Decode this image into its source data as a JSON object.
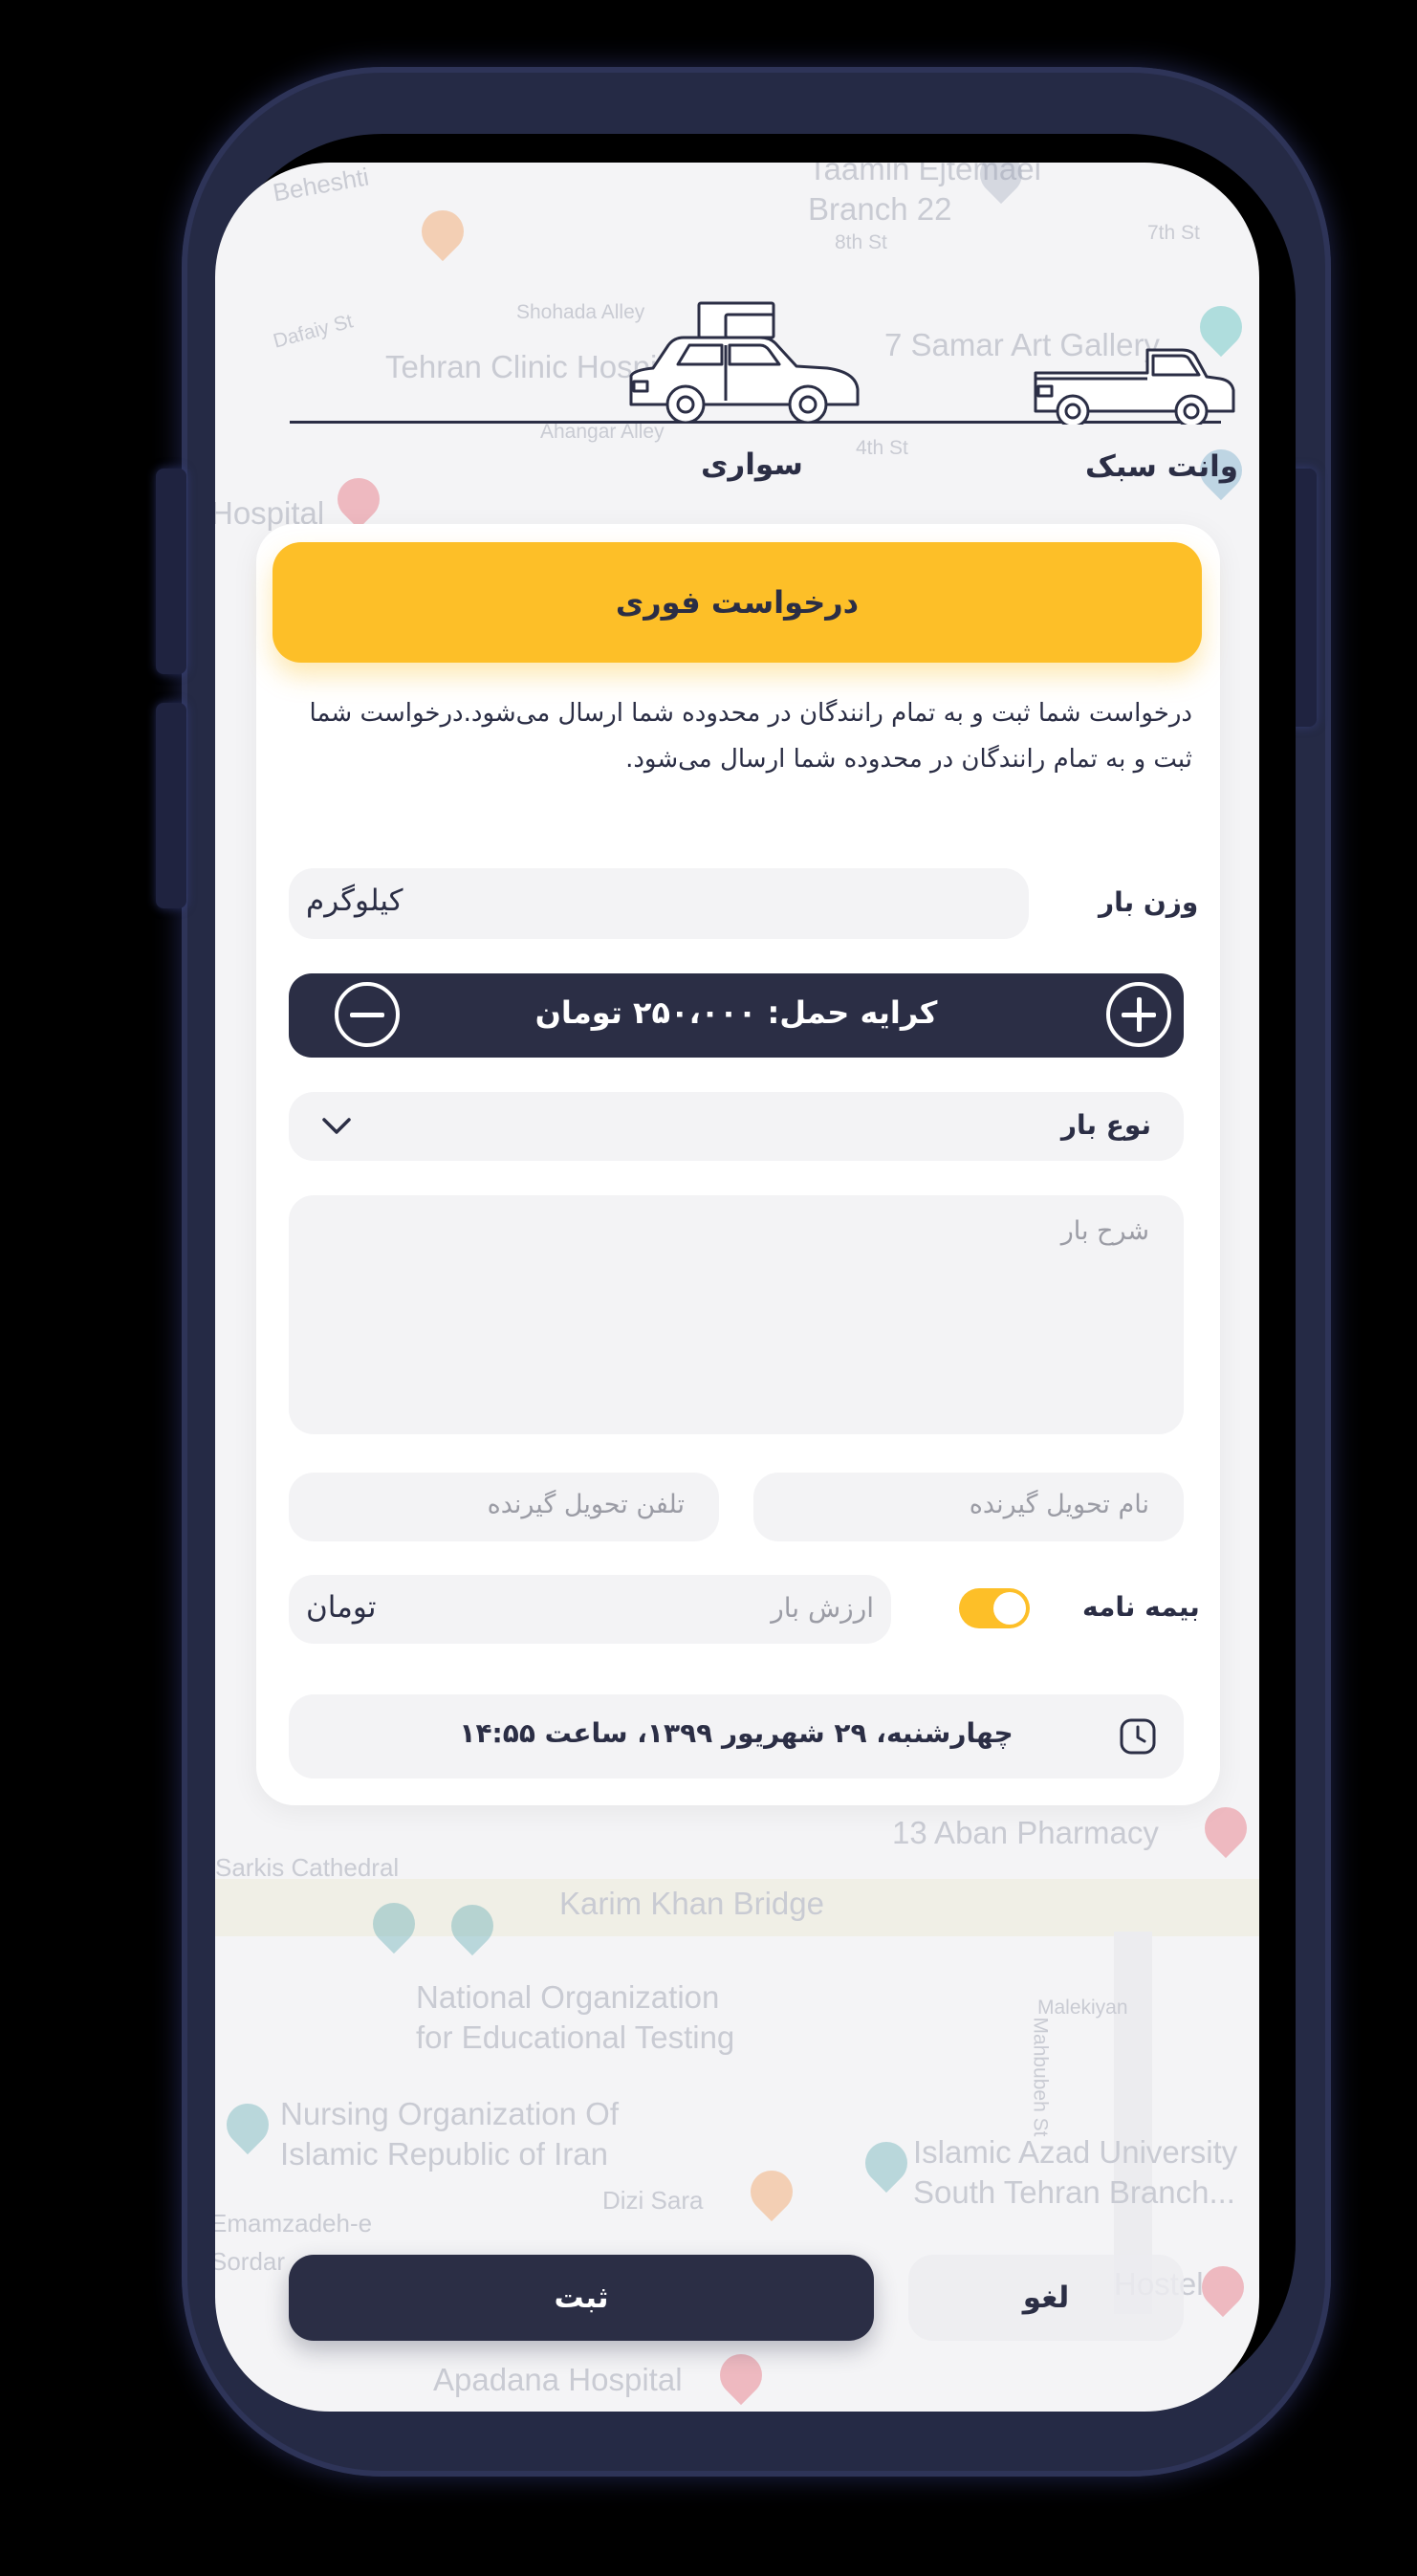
{
  "map": {
    "labels": [
      "Beheshti",
      "Taamin Ejtemaei",
      "Branch 22",
      "8th St",
      "7th St",
      "Shohada Alley",
      "Dafaiy St",
      "Tehran Clinic Hospital",
      "7 Samar Art Gallery",
      "Ahangar Alley",
      "4th St",
      "Hospital",
      "13 Aban Pharmacy",
      "Sarkis Cathedral",
      "Karim Khan Bridge",
      "National Organization",
      "for Educational Testing",
      "Mahbubeh St",
      "Malekiyan",
      "Nursing Organization Of",
      "Islamic Republic of Iran",
      "Islamic Azad University",
      "South Tehran Branch...",
      "Dizi Sara",
      "Emamzadeh-e",
      "Sordar",
      "Hostel",
      "Apadana Hospital"
    ]
  },
  "vehicles": [
    {
      "label": "سواری",
      "icon": "sedan-car-icon"
    },
    {
      "label": "وانت سبک",
      "icon": "pickup-truck-icon"
    }
  ],
  "form": {
    "instant_request_label": "درخواست فوری",
    "description": "درخواست شما ثبت و به تمام رانندگان در محدوده شما ارسال می‌شود.درخواست شما ثبت و به تمام رانندگان در محدوده شما ارسال می‌شود.",
    "weight_label": "وزن بار",
    "weight_placeholder": "کیلوگرم",
    "fare_text": "کرایه حمل: ۲۵۰،۰۰۰ تومان",
    "cargo_type_label": "نوع بار",
    "cargo_desc_placeholder": "شرح بار",
    "receiver_name_placeholder": "نام تحویل گیرنده",
    "receiver_phone_placeholder": "تلفن تحویل گیرنده",
    "insurance_label": "بیمه نامه",
    "insurance_enabled": true,
    "cargo_value_placeholder": "ارزش بار",
    "cargo_value_unit": "تومان",
    "datetime": "چهارشنبه، ۲۹ شهریور ۱۳۹۹، ساعت ۱۴:۵۵"
  },
  "actions": {
    "submit_label": "ثبت",
    "cancel_label": "لغو"
  },
  "colors": {
    "accent": "#fdbf28",
    "dark": "#2b2e45",
    "field_bg": "#f3f3f5",
    "screen_bg": "#f4f4f6"
  }
}
